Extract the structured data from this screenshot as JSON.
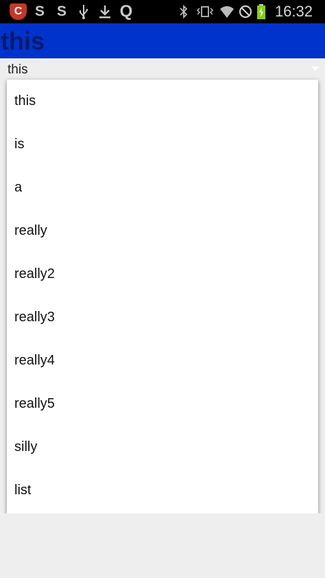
{
  "status_bar": {
    "notification_icons": [
      "shield-app-icon",
      "s-app-icon",
      "s-app-icon",
      "usb-icon",
      "download-icon",
      "q-app-icon"
    ],
    "letters": {
      "s1": "S",
      "s2": "S",
      "q": "Q"
    },
    "system_icons": [
      "bluetooth-icon",
      "vibrate-icon",
      "wifi-icon",
      "no-signal-icon",
      "battery-charging-icon"
    ],
    "time": "16:32"
  },
  "action_bar": {
    "title": "this",
    "background_color": "#0033cc",
    "title_color": "#0a1a6b"
  },
  "spinner": {
    "selected_value": "this"
  },
  "dropdown": {
    "items": [
      {
        "label": "this"
      },
      {
        "label": "is"
      },
      {
        "label": "a"
      },
      {
        "label": "really"
      },
      {
        "label": "really2"
      },
      {
        "label": "really3"
      },
      {
        "label": "really4"
      },
      {
        "label": "really5"
      },
      {
        "label": "silly"
      },
      {
        "label": "list"
      }
    ]
  }
}
